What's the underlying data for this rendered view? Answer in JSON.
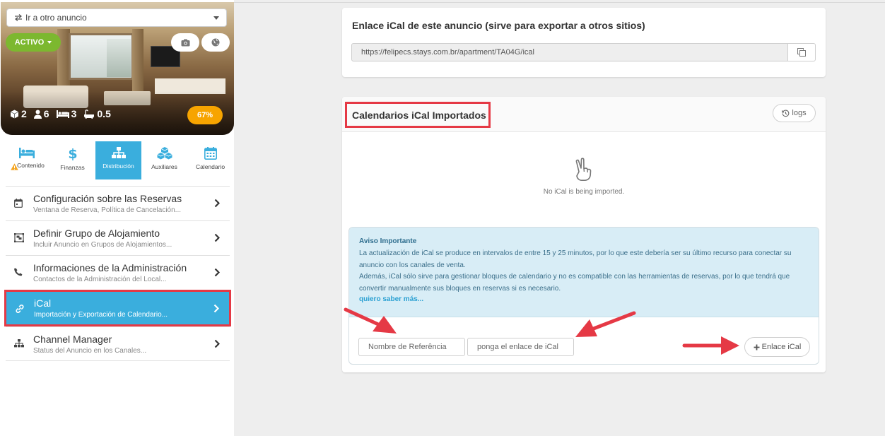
{
  "sidebar": {
    "goto_label": "Ir a otro anuncio",
    "status_label": "ACTIVO",
    "stats": [
      "2",
      "6",
      "3",
      "0.5"
    ],
    "percent": "67%",
    "tabs": [
      {
        "label": "Contenido"
      },
      {
        "label": "Finanzas"
      },
      {
        "label": "Distribución"
      },
      {
        "label": "Auxiliares"
      },
      {
        "label": "Calendario"
      }
    ],
    "menu": [
      {
        "title": "Configuración sobre las Reservas",
        "subtitle": "Ventana de Reserva, Política de Cancelación..."
      },
      {
        "title": "Definir Grupo de Alojamiento",
        "subtitle": "Incluir Anuncio en Grupos de Alojamientos..."
      },
      {
        "title": "Informaciones de la Administración",
        "subtitle": "Contactos de la Administración del Local..."
      },
      {
        "title": "iCal",
        "subtitle": "Importación y Exportación de Calendario..."
      },
      {
        "title": "Channel Manager",
        "subtitle": "Status del Anuncio en los Canales..."
      }
    ]
  },
  "export": {
    "title": "Enlace iCal de este anuncio (sirve para exportar a otros sitios)",
    "url": "https://felipecs.stays.com.br/apartment/TA04G/ical"
  },
  "import": {
    "title": "Calendarios iCal Importados",
    "logs_label": "logs",
    "empty_text": "No iCal is being imported.",
    "notice": {
      "title": "Aviso Importante",
      "p1": "La actualización de iCal se produce en intervalos de entre 15 y 25 minutos, por lo que este debería ser su último recurso para conectar su anuncio con los canales de venta.",
      "p2": "Además, iCal sólo sirve para gestionar bloques de calendario y no es compatible con las herramientas de reservas, por lo que tendrá que convertir manualmente sus bloques en reservas si es necesario.",
      "link": "quiero saber más..."
    },
    "ref_placeholder": "Nombre de Referência",
    "link_placeholder": "ponga el enlace de iCal",
    "add_label": "Enlace iCal"
  },
  "colors": {
    "accent": "#3aaedd",
    "status_green": "#7cb82f",
    "badge_orange": "#f7a400",
    "highlight_red": "#e53945"
  }
}
